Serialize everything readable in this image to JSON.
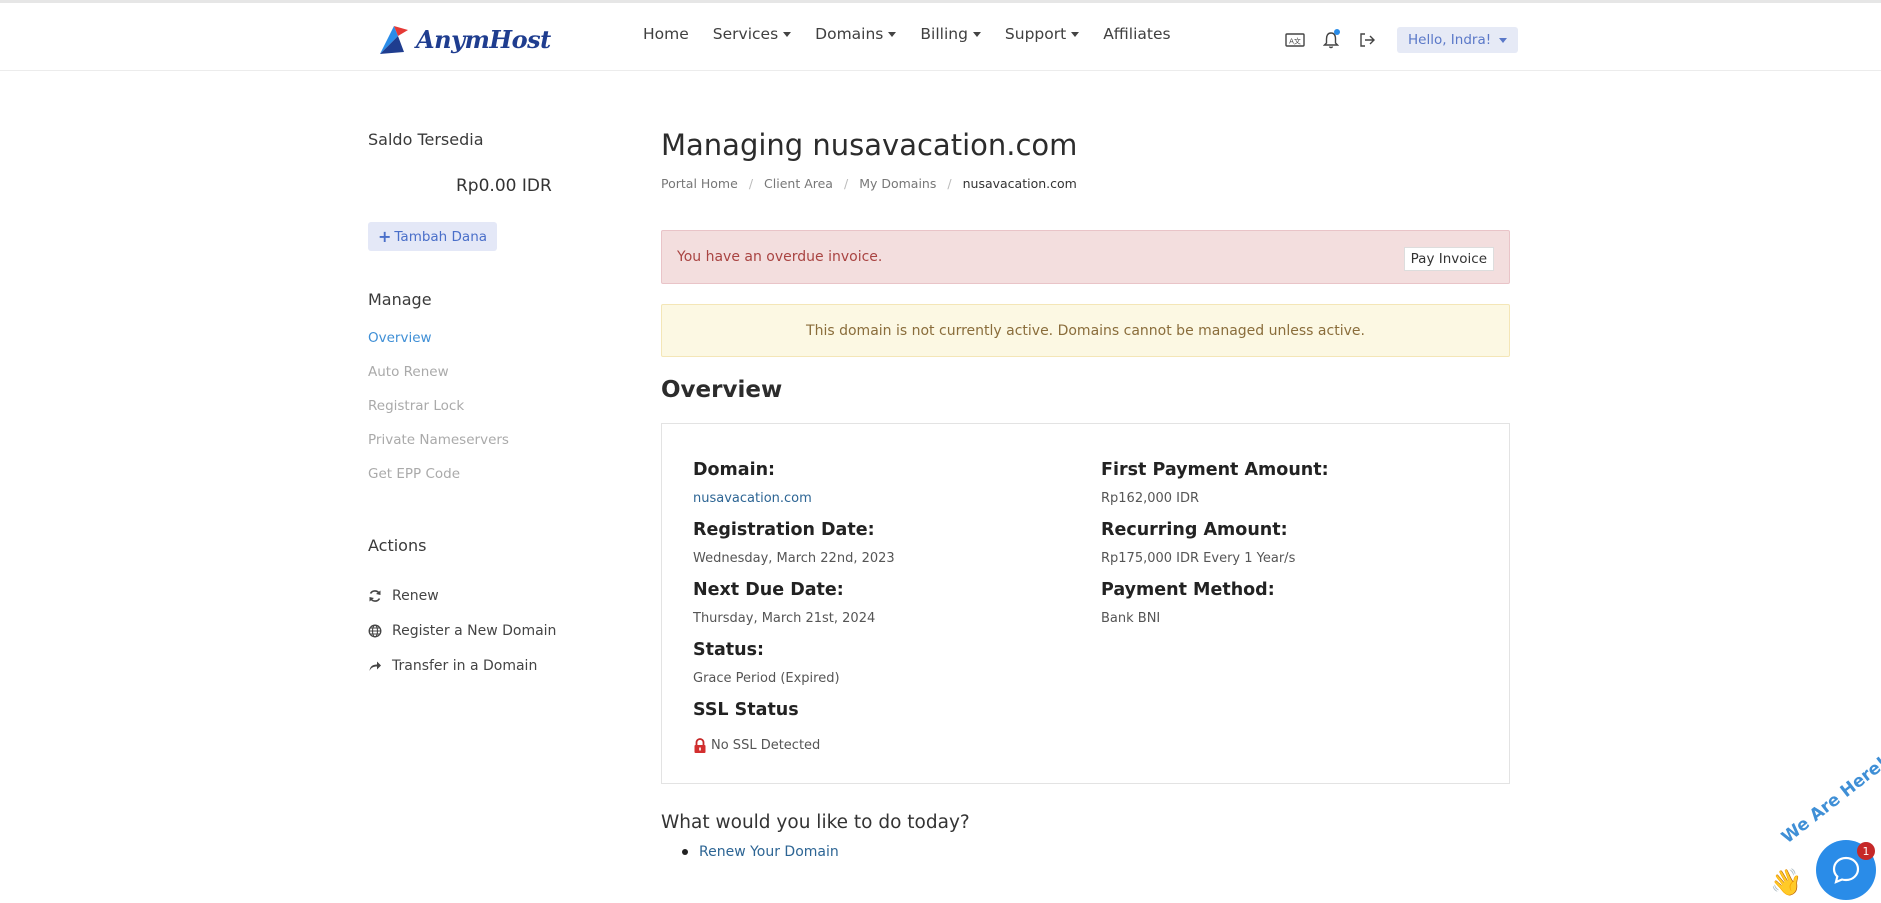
{
  "brand": {
    "logo_text": "AnymHost",
    "colors": {
      "primary": "#2a8ce8",
      "danger": "#a94442",
      "warning": "#8a6d3b",
      "link": "#2d6594"
    }
  },
  "nav": {
    "items": [
      {
        "label": "Home",
        "dropdown": false
      },
      {
        "label": "Services",
        "dropdown": true
      },
      {
        "label": "Domains",
        "dropdown": true
      },
      {
        "label": "Billing",
        "dropdown": true
      },
      {
        "label": "Support",
        "dropdown": true
      },
      {
        "label": "Affiliates",
        "dropdown": false
      }
    ],
    "icons": [
      "currency-icon",
      "bell-icon",
      "logout-icon"
    ],
    "greeting": "Hello, Indra!"
  },
  "sidebar": {
    "saldo_title": "Saldo Tersedia",
    "saldo_amount": "Rp0.00 IDR",
    "topup_label": "Tambah Dana",
    "manage_heading": "Manage",
    "manage_links": [
      {
        "label": "Overview",
        "active": true
      },
      {
        "label": "Auto Renew",
        "active": false
      },
      {
        "label": "Registrar Lock",
        "active": false
      },
      {
        "label": "Private Nameservers",
        "active": false
      },
      {
        "label": "Get EPP Code",
        "active": false
      }
    ],
    "actions_heading": "Actions",
    "actions": [
      {
        "label": "Renew",
        "icon": "refresh-icon"
      },
      {
        "label": "Register a New Domain",
        "icon": "globe-icon"
      },
      {
        "label": "Transfer in a Domain",
        "icon": "share-icon"
      }
    ]
  },
  "main": {
    "title": "Managing nusavacation.com",
    "breadcrumb": [
      "Portal Home",
      "Client Area",
      "My Domains",
      "nusavacation.com"
    ],
    "alert_overdue": "You have an overdue invoice.",
    "pay_invoice_label": "Pay Invoice",
    "alert_inactive": "This domain is not currently active. Domains cannot be managed unless active.",
    "overview_title": "Overview",
    "overview": {
      "left": [
        {
          "label": "Domain:",
          "value": "nusavacation.com",
          "link": true
        },
        {
          "label": "Registration Date:",
          "value": "Wednesday, March 22nd, 2023"
        },
        {
          "label": "Next Due Date:",
          "value": "Thursday, March 21st, 2024"
        },
        {
          "label": "Status:",
          "value": "Grace Period (Expired)"
        },
        {
          "label": "SSL Status",
          "value": "No SSL Detected",
          "icon": "lock-icon"
        }
      ],
      "right": [
        {
          "label": "First Payment Amount:",
          "value": "Rp162,000 IDR"
        },
        {
          "label": "Recurring Amount:",
          "value": "Rp175,000 IDR Every 1 Year/s"
        },
        {
          "label": "Payment Method:",
          "value": "Bank BNI"
        }
      ]
    },
    "todo_title": "What would you like to do today?",
    "todo_items": [
      "Renew Your Domain"
    ]
  },
  "chat": {
    "text": "We Are Here!",
    "badge": "1"
  }
}
